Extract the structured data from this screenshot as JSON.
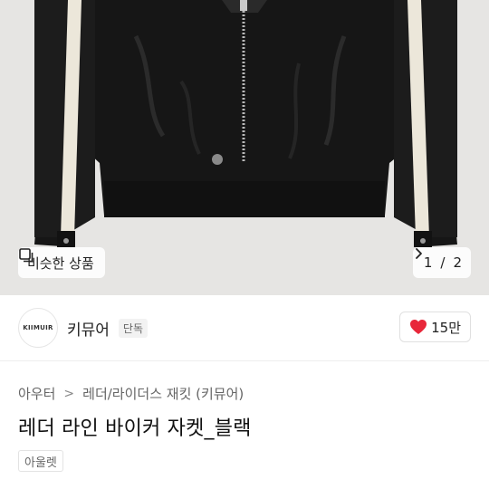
{
  "product_image": {
    "alt_icon": "jacket-photo",
    "similar_button": {
      "label": "비슷한 상품",
      "icon": "similar-items-icon"
    },
    "pager": {
      "current": "1",
      "separator": "/",
      "total": "2",
      "icon": "chevron-right-icon"
    }
  },
  "brand": {
    "logo_text": "KIIMUIR",
    "name": "키뮤어",
    "badge": "단독",
    "like": {
      "icon": "heart-icon",
      "count": "15만",
      "color": "#e8273a"
    }
  },
  "breadcrumb": {
    "items": [
      "아우터",
      "레더/라이더스 재킷 (키뮤어)"
    ],
    "separator": ">"
  },
  "product": {
    "title": "레더 라인 바이커 자켓_블랙",
    "tag": "아울렛"
  }
}
